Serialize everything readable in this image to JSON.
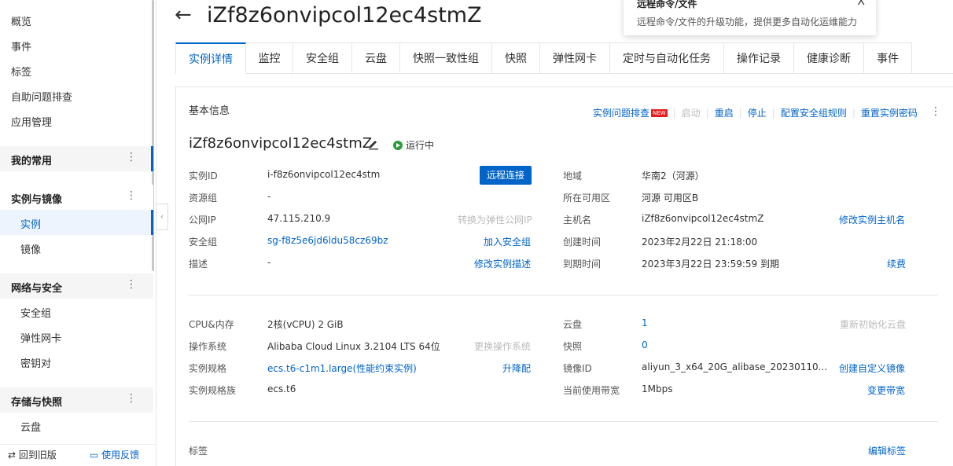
{
  "sidebar": {
    "top_items": [
      "概览",
      "事件",
      "标签",
      "自助问题排查",
      "应用管理"
    ],
    "groups": {
      "favorites": "我的常用",
      "instances_images": "实例与镜像",
      "network_security": "网络与安全",
      "storage_snapshots": "存储与快照"
    },
    "instances_items": [
      "实例",
      "镜像"
    ],
    "network_items": [
      "安全组",
      "弹性网卡",
      "密钥对"
    ],
    "storage_items": [
      "云盘"
    ],
    "bottom": {
      "back_old": "回到旧版",
      "feedback": "使用反馈"
    }
  },
  "header": {
    "back_icon": "arrow-left-icon",
    "title": "iZf8z6onvipcol12ec4stmZ"
  },
  "tooltip": {
    "title": "远程命令/文件",
    "body": "远程命令/文件的升级功能，提供更多自动化运维能力",
    "close": "X"
  },
  "tabs": [
    "实例详情",
    "监控",
    "安全组",
    "云盘",
    "快照一致性组",
    "快照",
    "弹性网卡",
    "定时与自动化任务",
    "操作记录",
    "健康诊断",
    "事件"
  ],
  "basic": {
    "section_title": "基本信息",
    "actions": {
      "troubleshoot": "实例问题排查",
      "new_badge": "NEW",
      "start": "启动",
      "restart": "重启",
      "stop": "停止",
      "sg_rules": "配置安全组规则",
      "reset_pwd": "重置实例密码"
    },
    "name": "iZf8z6onvipcol12ec4stmZ",
    "status": "运行中",
    "remote_connect": "远程连接",
    "left": {
      "instance_id_label": "实例ID",
      "instance_id": "i-f8z6onvipcol12ec4stm",
      "resource_group_label": "资源组",
      "resource_group": "-",
      "public_ip_label": "公网IP",
      "public_ip": "47.115.210.9",
      "public_ip_action": "转换为弹性公网IP",
      "security_group_label": "安全组",
      "security_group": "sg-f8z5e6jd6ldu58cz69bz",
      "security_group_action": "加入安全组",
      "description_label": "描述",
      "description": "-",
      "description_action": "修改实例描述"
    },
    "right": {
      "region_label": "地域",
      "region": "华南2（河源）",
      "zone_label": "所在可用区",
      "zone": "河源 可用区B",
      "hostname_label": "主机名",
      "hostname": "iZf8z6onvipcol12ec4stmZ",
      "hostname_action": "修改实例主机名",
      "created_label": "创建时间",
      "created": "2023年2月22日 21:18:00",
      "expire_label": "到期时间",
      "expire": "2023年3月22日 23:59:59 到期",
      "expire_action": "续费"
    }
  },
  "config": {
    "left": {
      "cpu_mem_label": "CPU&内存",
      "cpu_mem": "2核(vCPU) 2 GiB",
      "os_label": "操作系统",
      "os": "Alibaba Cloud Linux 3.2104 LTS 64位",
      "os_action": "更换操作系统",
      "spec_label": "实例规格",
      "spec": "ecs.t6-c1m1.large(性能约束实例)",
      "spec_action": "升降配",
      "family_label": "实例规格族",
      "family": "ecs.t6"
    },
    "right": {
      "disk_label": "云盘",
      "disk": "1",
      "disk_action": "重新初始化云盘",
      "snapshot_label": "快照",
      "snapshot": "0",
      "image_label": "镜像ID",
      "image": "aliyun_3_x64_20G_alibase_20230110...",
      "image_action": "创建自定义镜像",
      "bandwidth_label": "当前使用带宽",
      "bandwidth": "1Mbps",
      "bandwidth_action": "变更带宽"
    }
  },
  "tags": {
    "label": "标签",
    "action": "编辑标签"
  }
}
